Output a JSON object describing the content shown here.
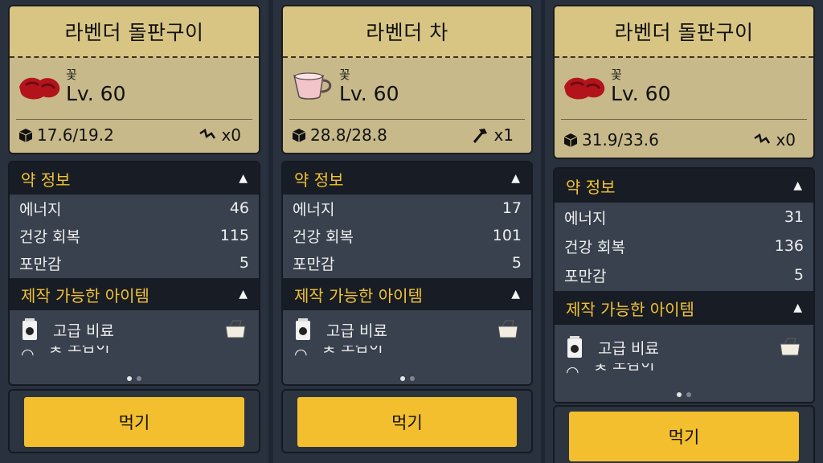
{
  "panels": [
    {
      "title": "라벤더 돌판구이",
      "category": "꽃",
      "level": "Lv. 60",
      "weight": "17.6/19.2",
      "extra_value": "x0",
      "extra_icon": "swap-arrow-icon",
      "item_icon": "grilled-meat-icon",
      "info_header": "약 정보",
      "stats": [
        {
          "label": "에너지",
          "value": "46"
        },
        {
          "label": "건강 회복",
          "value": "115"
        },
        {
          "label": "포만감",
          "value": "5"
        }
      ],
      "craft_header": "제작 가능한 아이템",
      "craft_items": [
        {
          "label": "고급 비료"
        }
      ],
      "partial_item": "꽃 도감이",
      "eat_label": "먹기"
    },
    {
      "title": "라벤더 차",
      "category": "꽃",
      "level": "Lv. 60",
      "weight": "28.8/28.8",
      "extra_value": "x1",
      "extra_icon": "hammer-icon",
      "item_icon": "tea-cup-icon",
      "info_header": "약 정보",
      "stats": [
        {
          "label": "에너지",
          "value": "17"
        },
        {
          "label": "건강 회복",
          "value": "101"
        },
        {
          "label": "포만감",
          "value": "5"
        }
      ],
      "craft_header": "제작 가능한 아이템",
      "craft_items": [
        {
          "label": "고급 비료"
        }
      ],
      "partial_item": "꽃 도감이",
      "eat_label": "먹기"
    },
    {
      "title": "라벤더 돌판구이",
      "category": "꽃",
      "level": "Lv. 60",
      "weight": "31.9/33.6",
      "extra_value": "x0",
      "extra_icon": "swap-arrow-icon",
      "item_icon": "grilled-meat-icon",
      "info_header": "약 정보",
      "stats": [
        {
          "label": "에너지",
          "value": "31"
        },
        {
          "label": "건강 회복",
          "value": "136"
        },
        {
          "label": "포만감",
          "value": "5"
        }
      ],
      "craft_header": "제작 가능한 아이템",
      "craft_items": [
        {
          "label": "고급 비료"
        }
      ],
      "partial_item": "꽃 도감이",
      "eat_label": "먹기"
    }
  ],
  "colors": {
    "accent_yellow": "#f3bf2e",
    "header_gold": "#f2c233",
    "card_tan": "#c8b98b",
    "dark_bg": "#171c25"
  }
}
